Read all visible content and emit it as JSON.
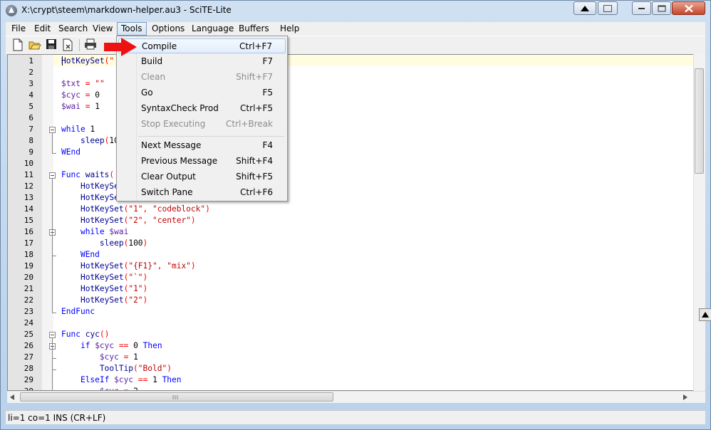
{
  "window": {
    "title": "X:\\crypt\\steem\\markdown-helper.au3 - SciTE-Lite"
  },
  "menubar": {
    "items": [
      "File",
      "Edit",
      "Search",
      "View",
      "Tools",
      "Options",
      "Language",
      "Buffers",
      "Help"
    ],
    "active": "Tools"
  },
  "toolbar": {
    "buttons": [
      "new-file-icon",
      "open-folder-icon",
      "save-icon",
      "close-file-icon",
      "print-icon"
    ]
  },
  "tools_menu": {
    "items": [
      {
        "label": "Compile",
        "accel": "Ctrl+F7",
        "enabled": true,
        "highlighted": true
      },
      {
        "label": "Build",
        "accel": "F7",
        "enabled": true
      },
      {
        "label": "Clean",
        "accel": "Shift+F7",
        "enabled": false
      },
      {
        "label": "Go",
        "accel": "F5",
        "enabled": true
      },
      {
        "label": "SyntaxCheck Prod",
        "accel": "Ctrl+F5",
        "enabled": true
      },
      {
        "label": "Stop Executing",
        "accel": "Ctrl+Break",
        "enabled": false
      },
      {
        "label": "Next Message",
        "accel": "F4",
        "enabled": true
      },
      {
        "label": "Previous Message",
        "accel": "Shift+F4",
        "enabled": true
      },
      {
        "label": "Clear Output",
        "accel": "Shift+F5",
        "enabled": true
      },
      {
        "label": "Switch Pane",
        "accel": "Ctrl+F6",
        "enabled": true
      }
    ]
  },
  "editor": {
    "line_numbers": [
      "1",
      "2",
      "3",
      "4",
      "5",
      "6",
      "7",
      "8",
      "9",
      "10",
      "11",
      "12",
      "13",
      "14",
      "15",
      "16",
      "17",
      "18",
      "19",
      "20",
      "21",
      "22",
      "23",
      "24",
      "25",
      "26",
      "27",
      "28",
      "29",
      "30"
    ],
    "lines": [
      [
        [
          "fn",
          "HotKeySet"
        ],
        [
          "op",
          "(\""
        ]
      ],
      [],
      [
        [
          "var",
          "$txt"
        ],
        [
          "plain",
          " "
        ],
        [
          "op",
          "="
        ],
        [
          "plain",
          " "
        ],
        [
          "str",
          "\"\""
        ]
      ],
      [
        [
          "var",
          "$cyc"
        ],
        [
          "plain",
          " "
        ],
        [
          "op",
          "="
        ],
        [
          "plain",
          " "
        ],
        [
          "num",
          "0"
        ]
      ],
      [
        [
          "var",
          "$wai"
        ],
        [
          "plain",
          " "
        ],
        [
          "op",
          "="
        ],
        [
          "plain",
          " "
        ],
        [
          "num",
          "1"
        ]
      ],
      [],
      [
        [
          "kw",
          "while"
        ],
        [
          "plain",
          " "
        ],
        [
          "num",
          "1"
        ]
      ],
      [
        [
          "plain",
          "    "
        ],
        [
          "fn",
          "sleep"
        ],
        [
          "op",
          "("
        ],
        [
          "num",
          "10"
        ]
      ],
      [
        [
          "kw",
          "WEnd"
        ]
      ],
      [],
      [
        [
          "kw",
          "Func"
        ],
        [
          "plain",
          " "
        ],
        [
          "fn",
          "waits"
        ],
        [
          "op",
          "("
        ]
      ],
      [
        [
          "plain",
          "    "
        ],
        [
          "fn",
          "HotKeySe"
        ]
      ],
      [
        [
          "plain",
          "    "
        ],
        [
          "fn",
          "HotKeySe"
        ]
      ],
      [
        [
          "plain",
          "    "
        ],
        [
          "fn",
          "HotKeySet"
        ],
        [
          "op",
          "("
        ],
        [
          "str",
          "\"1\""
        ],
        [
          "op",
          ", "
        ],
        [
          "str",
          "\"codeblock\""
        ],
        [
          "op",
          ")"
        ]
      ],
      [
        [
          "plain",
          "    "
        ],
        [
          "fn",
          "HotKeySet"
        ],
        [
          "op",
          "("
        ],
        [
          "str",
          "\"2\""
        ],
        [
          "op",
          ", "
        ],
        [
          "str",
          "\"center\""
        ],
        [
          "op",
          ")"
        ]
      ],
      [
        [
          "plain",
          "    "
        ],
        [
          "kw",
          "while"
        ],
        [
          "plain",
          " "
        ],
        [
          "var",
          "$wai"
        ]
      ],
      [
        [
          "plain",
          "        "
        ],
        [
          "fn",
          "sleep"
        ],
        [
          "op",
          "("
        ],
        [
          "num",
          "100"
        ],
        [
          "op",
          ")"
        ]
      ],
      [
        [
          "plain",
          "    "
        ],
        [
          "kw",
          "WEnd"
        ]
      ],
      [
        [
          "plain",
          "    "
        ],
        [
          "fn",
          "HotKeySet"
        ],
        [
          "op",
          "("
        ],
        [
          "str",
          "\"{F1}\""
        ],
        [
          "op",
          ", "
        ],
        [
          "str",
          "\"mix\""
        ],
        [
          "op",
          ")"
        ]
      ],
      [
        [
          "plain",
          "    "
        ],
        [
          "fn",
          "HotKeySet"
        ],
        [
          "op",
          "("
        ],
        [
          "str",
          "\"`\""
        ],
        [
          "op",
          ")"
        ]
      ],
      [
        [
          "plain",
          "    "
        ],
        [
          "fn",
          "HotKeySet"
        ],
        [
          "op",
          "("
        ],
        [
          "str",
          "\"1\""
        ],
        [
          "op",
          ")"
        ]
      ],
      [
        [
          "plain",
          "    "
        ],
        [
          "fn",
          "HotKeySet"
        ],
        [
          "op",
          "("
        ],
        [
          "str",
          "\"2\""
        ],
        [
          "op",
          ")"
        ]
      ],
      [
        [
          "kw",
          "EndFunc"
        ]
      ],
      [],
      [
        [
          "kw",
          "Func"
        ],
        [
          "plain",
          " "
        ],
        [
          "fn",
          "cyc"
        ],
        [
          "op",
          "()"
        ]
      ],
      [
        [
          "plain",
          "    "
        ],
        [
          "kw",
          "if"
        ],
        [
          "plain",
          " "
        ],
        [
          "var",
          "$cyc"
        ],
        [
          "plain",
          " "
        ],
        [
          "op",
          "=="
        ],
        [
          "plain",
          " "
        ],
        [
          "num",
          "0"
        ],
        [
          "plain",
          " "
        ],
        [
          "kw",
          "Then"
        ]
      ],
      [
        [
          "plain",
          "        "
        ],
        [
          "var",
          "$cyc"
        ],
        [
          "plain",
          " "
        ],
        [
          "op",
          "="
        ],
        [
          "plain",
          " "
        ],
        [
          "num",
          "1"
        ]
      ],
      [
        [
          "plain",
          "        "
        ],
        [
          "fn",
          "ToolTip"
        ],
        [
          "op",
          "("
        ],
        [
          "str",
          "\"Bold\""
        ],
        [
          "op",
          ")"
        ]
      ],
      [
        [
          "plain",
          "    "
        ],
        [
          "kw",
          "ElseIf"
        ],
        [
          "plain",
          " "
        ],
        [
          "var",
          "$cyc"
        ],
        [
          "plain",
          " "
        ],
        [
          "op",
          "=="
        ],
        [
          "plain",
          " "
        ],
        [
          "num",
          "1"
        ],
        [
          "plain",
          " "
        ],
        [
          "kw",
          "Then"
        ]
      ],
      [
        [
          "plain",
          "        "
        ],
        [
          "var",
          "$cyc"
        ],
        [
          "plain",
          " "
        ],
        [
          "op",
          "="
        ],
        [
          "plain",
          " "
        ],
        [
          "num",
          "2"
        ]
      ]
    ]
  },
  "status": {
    "text": "li=1 co=1 INS (CR+LF)"
  }
}
